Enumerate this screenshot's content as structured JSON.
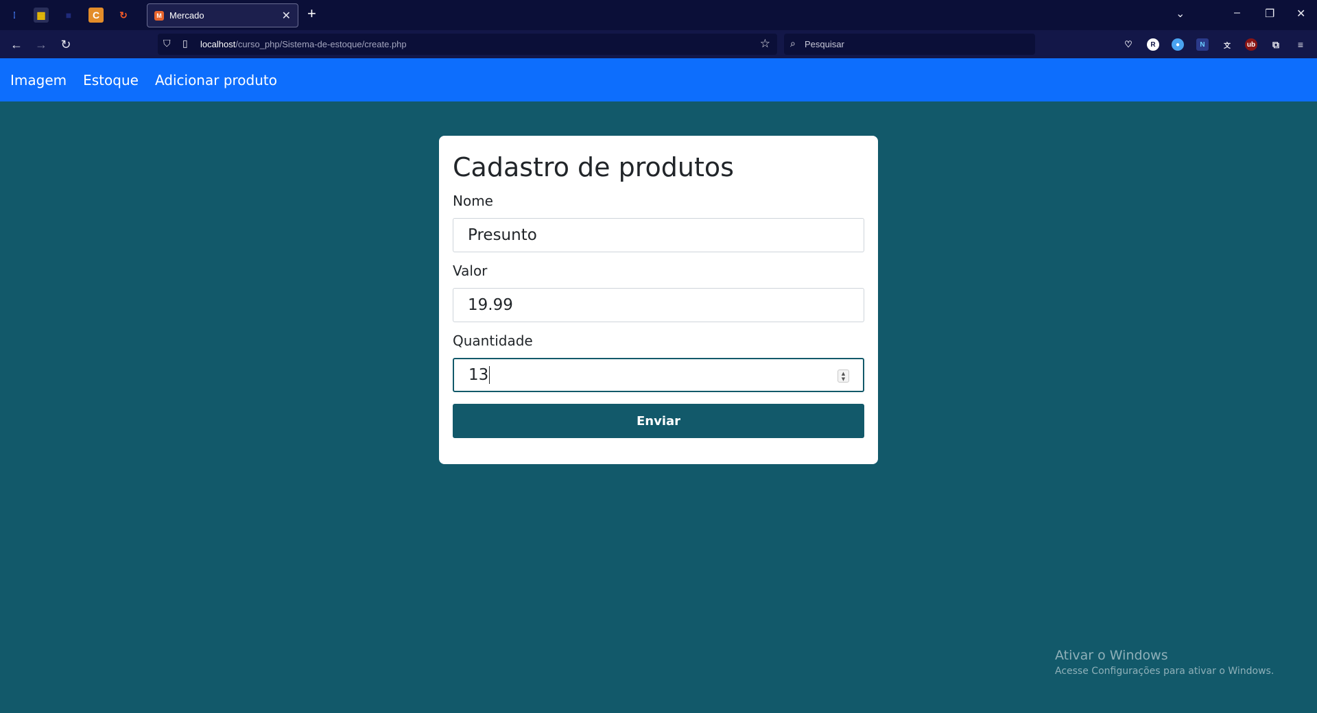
{
  "browser": {
    "tab_title": "Mercado",
    "tab_favicon": "M",
    "url_host": "localhost",
    "url_path": "/curso_php/Sistema-de-estoque/create.php",
    "search_placeholder": "Pesquisar"
  },
  "site_nav": {
    "items": [
      {
        "label": "Imagem"
      },
      {
        "label": "Estoque"
      },
      {
        "label": "Adicionar produto"
      }
    ]
  },
  "form": {
    "title": "Cadastro de produtos",
    "fields": [
      {
        "label": "Nome",
        "value": "Presunto"
      },
      {
        "label": "Valor",
        "value": "19.99"
      },
      {
        "label": "Quantidade",
        "value": "13"
      }
    ],
    "submit_label": "Enviar"
  },
  "watermark": {
    "title": "Ativar o Windows",
    "subtitle": "Acesse Configurações para ativar o Windows."
  },
  "colors": {
    "background": "#12596a",
    "nav": "#0d6efd",
    "button": "#12596a"
  }
}
